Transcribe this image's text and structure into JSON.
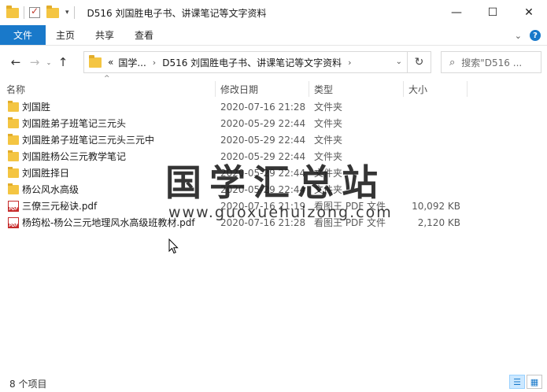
{
  "window": {
    "title": "D516 刘国胜电子书、讲课笔记等文字资料",
    "minimize_glyph": "—",
    "maximize_glyph": "☐",
    "close_glyph": "✕"
  },
  "ribbon": {
    "file_tab": "文件",
    "tabs": [
      "主页",
      "共享",
      "查看"
    ],
    "expand_glyph": "⌄",
    "help_glyph": "?"
  },
  "nav": {
    "back_glyph": "←",
    "forward_glyph": "→",
    "up_glyph": "↑",
    "dropdown_glyph": "⌄",
    "breadcrumb": [
      "«",
      "国学...",
      "D516 刘国胜电子书、讲课笔记等文字资料"
    ],
    "refresh_glyph": "↻",
    "search_placeholder": "搜索\"D516 ..."
  },
  "columns": {
    "name": "名称",
    "date": "修改日期",
    "type": "类型",
    "size": "大小"
  },
  "files": [
    {
      "name": "刘国胜",
      "date": "2020-07-16 21:28",
      "type": "文件夹",
      "size": "",
      "icon": "folder-icon"
    },
    {
      "name": "刘国胜弟子班笔记三元头",
      "date": "2020-05-29 22:44",
      "type": "文件夹",
      "size": "",
      "icon": "folder-icon"
    },
    {
      "name": "刘国胜弟子班笔记三元头三元中",
      "date": "2020-05-29 22:44",
      "type": "文件夹",
      "size": "",
      "icon": "folder-icon"
    },
    {
      "name": "刘国胜杨公三元教学笔记",
      "date": "2020-05-29 22:44",
      "type": "文件夹",
      "size": "",
      "icon": "folder-icon"
    },
    {
      "name": "刘国胜择日",
      "date": "2020-05-29 22:44",
      "type": "文件夹",
      "size": "",
      "icon": "folder-icon"
    },
    {
      "name": "杨公风水高级",
      "date": "2020-05-29 22:44",
      "type": "文件夹",
      "size": "",
      "icon": "folder-icon"
    },
    {
      "name": "三僚三元秘诀.pdf",
      "date": "2020-07-16 21:19",
      "type": "看图王 PDF 文件",
      "size": "10,092 KB",
      "icon": "pdf-icon"
    },
    {
      "name": "杨筠松-杨公三元地理风水高级班教材.pdf",
      "date": "2020-07-16 21:28",
      "type": "看图王 PDF 文件",
      "size": "2,120 KB",
      "icon": "pdf-icon"
    }
  ],
  "watermark": {
    "main": "国学汇总站",
    "url": "www.guoxuehuizong.com"
  },
  "status": {
    "count": "8 个项目"
  }
}
